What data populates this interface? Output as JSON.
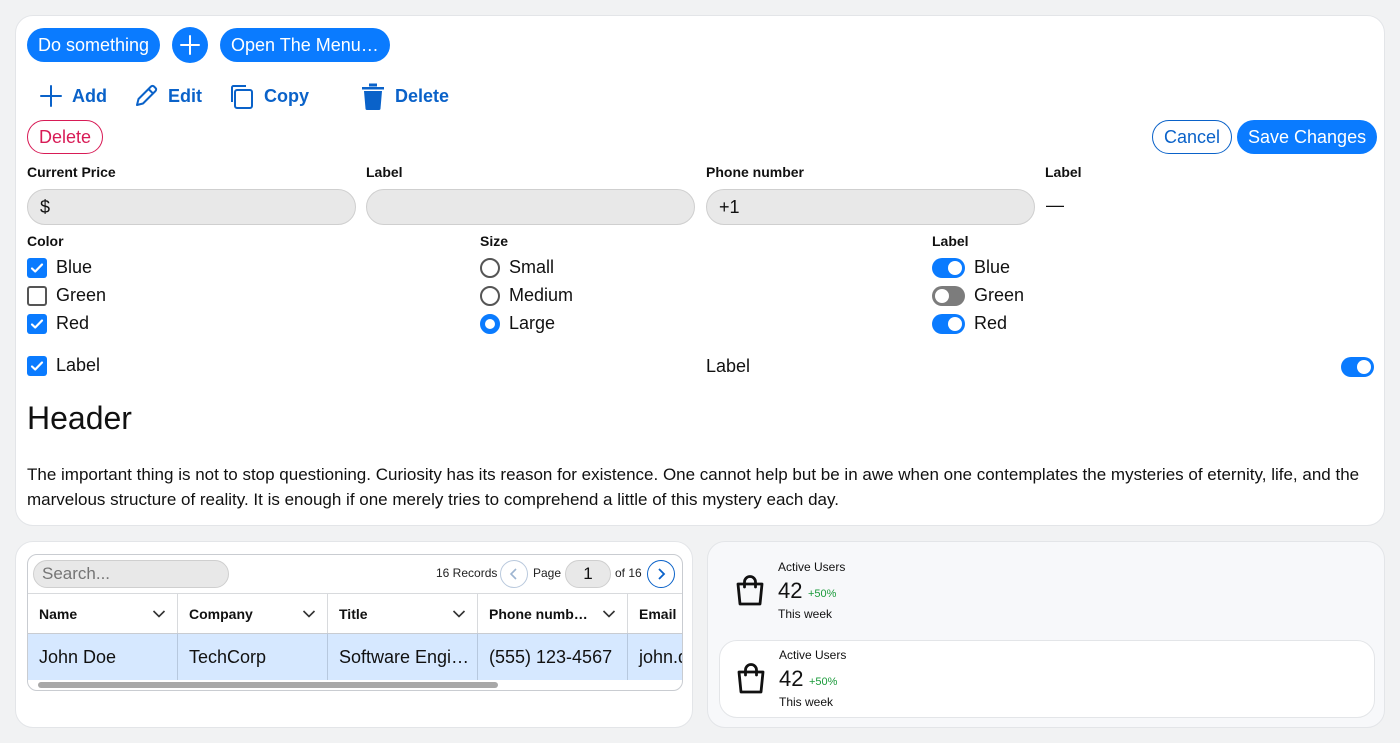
{
  "toolbar": {
    "do_something": "Do something",
    "open_menu": "Open The Menu…",
    "add": "Add",
    "edit": "Edit",
    "copy": "Copy",
    "delete": "Delete"
  },
  "actions": {
    "delete": "Delete",
    "cancel": "Cancel",
    "save": "Save Changes"
  },
  "form": {
    "price_label": "Current Price",
    "price_prefix": "$",
    "label2": "Label",
    "phone_label": "Phone number",
    "phone_prefix": "+1",
    "label4": "Label",
    "label4_value": "—"
  },
  "color_group": {
    "title": "Color",
    "options": [
      {
        "label": "Blue",
        "checked": true
      },
      {
        "label": "Green",
        "checked": false
      },
      {
        "label": "Red",
        "checked": true
      }
    ]
  },
  "size_group": {
    "title": "Size",
    "options": [
      {
        "label": "Small",
        "selected": false
      },
      {
        "label": "Medium",
        "selected": false
      },
      {
        "label": "Large",
        "selected": true
      }
    ]
  },
  "toggle_group": {
    "title": "Label",
    "options": [
      {
        "label": "Blue",
        "on": true
      },
      {
        "label": "Green",
        "on": false
      },
      {
        "label": "Red",
        "on": true
      }
    ]
  },
  "single_checkbox": {
    "label": "Label",
    "checked": true
  },
  "single_toggle": {
    "label": "Label",
    "on": true
  },
  "content": {
    "header": "Header",
    "paragraph": "The important thing is not to stop questioning. Curiosity has its reason for existence. One cannot help but be in awe when one contemplates the mysteries of eternity, life, and the marvelous structure of reality. It is enough if one merely tries to comprehend a little of this mystery each day."
  },
  "table": {
    "search_placeholder": "Search...",
    "records": "16 Records",
    "page_label": "Page",
    "page_value": "1",
    "of_label": "of 16",
    "columns": [
      "Name",
      "Company",
      "Title",
      "Phone numb…",
      "Email"
    ],
    "rows": [
      [
        "John Doe",
        "TechCorp",
        "Software Engi…",
        "(555) 123-4567",
        "john.d"
      ]
    ]
  },
  "stats": [
    {
      "title": "Active Users",
      "value": "42",
      "change": "+50%",
      "period": "This week"
    },
    {
      "title": "Active Users",
      "value": "42",
      "change": "+50%",
      "period": "This week"
    }
  ],
  "colors": {
    "accent": "#0a7bff",
    "tool_text": "#0a62c9",
    "danger": "#d81b56",
    "positive": "#1a9a3a",
    "selected_row": "#d6e8ff"
  }
}
